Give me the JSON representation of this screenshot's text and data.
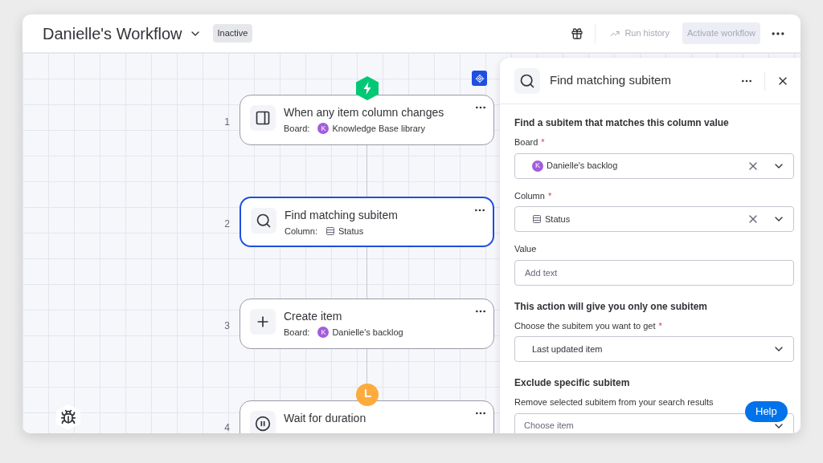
{
  "header": {
    "title": "Danielle's Workflow",
    "status": "Inactive",
    "run_history": {
      "label": "Run history",
      "disabled": true
    },
    "activate": {
      "label": "Activate workflow",
      "disabled": true
    }
  },
  "steps": [
    {
      "number": "1",
      "kind": "trigger",
      "title": "When any item column changes",
      "field_label": "Board:",
      "avatar": "K",
      "value": "Knowledge Base library",
      "selected": false
    },
    {
      "number": "2",
      "kind": "find",
      "title": "Find matching subitem",
      "field_label": "Column:",
      "value": "Status",
      "selected": true
    },
    {
      "number": "3",
      "kind": "create",
      "title": "Create item",
      "field_label": "Board:",
      "avatar": "K",
      "value": "Danielle's backlog",
      "selected": false
    },
    {
      "number": "4",
      "kind": "wait",
      "title": "Wait for duration",
      "selected": false
    }
  ],
  "panel": {
    "title": "Find matching subitem",
    "sections": [
      {
        "heading": "Find a subitem that matches this column value",
        "fields": [
          {
            "kind": "board",
            "label": "Board",
            "required_mark": "*",
            "avatar": "K",
            "value": "Danielle's backlog",
            "clearable": true
          },
          {
            "kind": "column",
            "label": "Column",
            "required_mark": "*",
            "value": "Status",
            "clearable": true
          },
          {
            "kind": "text",
            "label": "Value",
            "placeholder": "Add text"
          }
        ]
      },
      {
        "heading": "This action will give you only one subitem",
        "fields": [
          {
            "kind": "select",
            "label": "Choose the subitem you want to get",
            "required_mark": "*",
            "value": "Last updated item",
            "clearable": false
          }
        ]
      },
      {
        "heading": "Exclude specific subitem",
        "fields": [
          {
            "kind": "select",
            "label": "Remove selected subitem from your search results",
            "placeholder": "Choose item",
            "clearable": false
          }
        ]
      }
    ]
  },
  "help_button": "Help"
}
